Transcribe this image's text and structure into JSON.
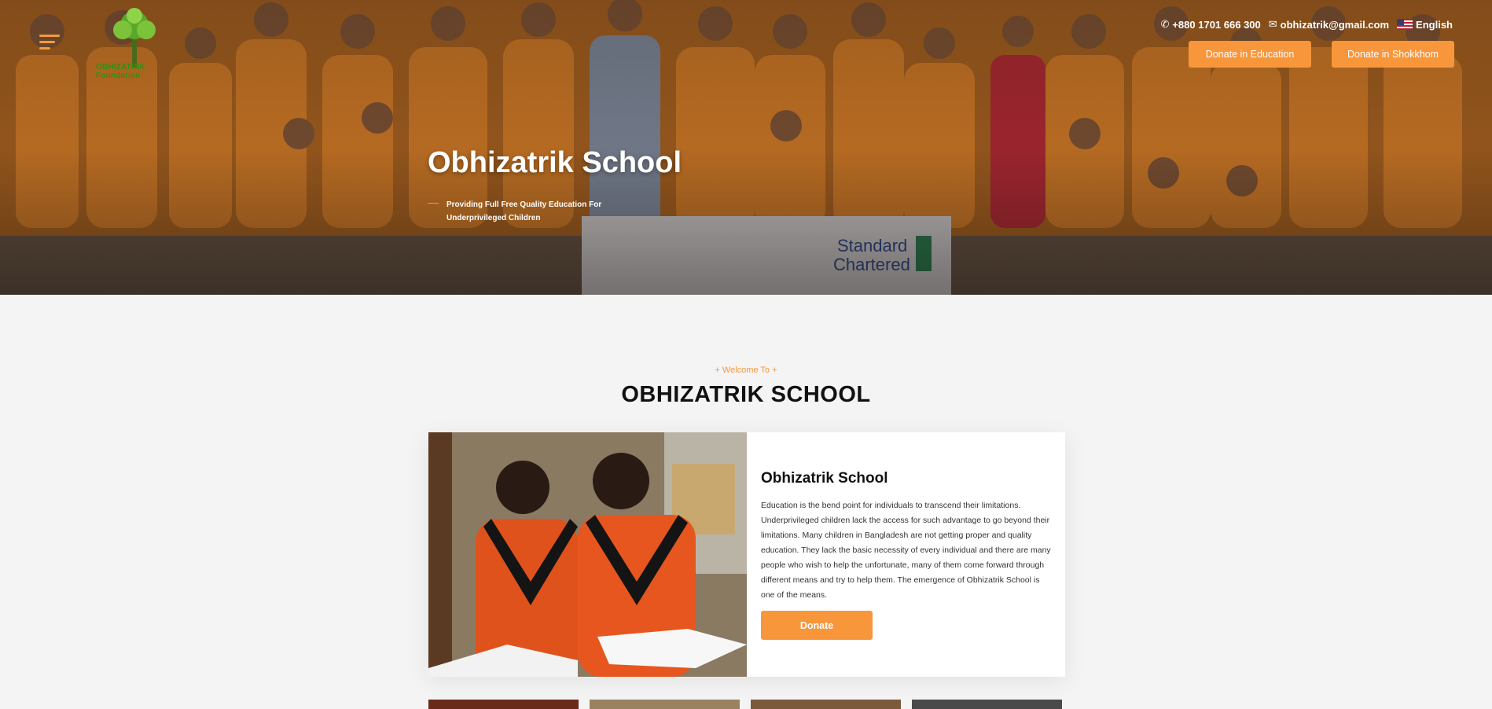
{
  "header": {
    "logo_text": "OBHIZATRIK Foundation",
    "phone": "+880 1701 666 300",
    "email": "obhizatrik@gmail.com",
    "language": "English",
    "donate_education": "Donate in Education",
    "donate_shokkhom": "Donate in Shokkhom"
  },
  "hero": {
    "title": "Obhizatrik School",
    "subtitle": "Providing Full Free Quality Education For Underprivileged Children"
  },
  "welcome": {
    "kicker": "+ Welcome To +",
    "title": "OBHIZATRIK SCHOOL"
  },
  "card": {
    "title": "Obhizatrik School",
    "text": "Education is the bend point for individuals to transcend their limitations. Underprivileged children lack the access for such advantage to go beyond their limitations. Many children in Bangladesh are not getting proper and quality education. They lack the basic necessity of every individual and there are many people who wish to help the unfortunate, many of them come forward through different means and try to help them. The emergence of Obhizatrik School is one of the means.",
    "button": "Donate"
  },
  "colors": {
    "accent": "#f7963a",
    "logo_green": "#3a8a14"
  }
}
